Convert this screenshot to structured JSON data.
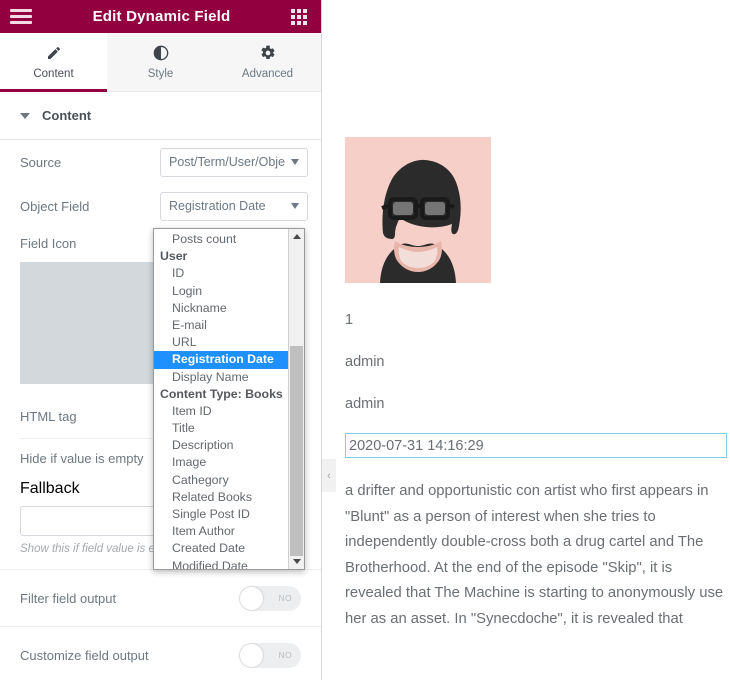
{
  "panel": {
    "title": "Edit Dynamic Field",
    "menu_icon": "hamburger-icon",
    "apps_icon": "grid-icon",
    "tabs": [
      {
        "label": "Content",
        "icon": "pencil-icon",
        "active": true
      },
      {
        "label": "Style",
        "icon": "contrast-icon",
        "active": false
      },
      {
        "label": "Advanced",
        "icon": "gear-icon",
        "active": false
      }
    ],
    "section": {
      "label": "Content",
      "expanded": true
    },
    "fields": {
      "source": {
        "label": "Source",
        "value": "Post/Term/User/Objec"
      },
      "object_field": {
        "label": "Object Field",
        "value": "Registration Date"
      },
      "field_icon": {
        "label": "Field Icon"
      },
      "html_tag": {
        "label": "HTML tag"
      },
      "hide_if_empty": {
        "label": "Hide if value is empty"
      },
      "fallback": {
        "label": "Fallback",
        "value": "",
        "hint": "Show this if field value is e"
      },
      "filter_field_output": {
        "label": "Filter field output",
        "state": "NO"
      },
      "customize_field_output": {
        "label": "Customize field output",
        "state": "NO"
      }
    }
  },
  "dropdown": {
    "selected": "Registration Date",
    "items": [
      {
        "label": "Posts count",
        "type": "item"
      },
      {
        "label": "User",
        "type": "group"
      },
      {
        "label": "ID",
        "type": "item"
      },
      {
        "label": "Login",
        "type": "item"
      },
      {
        "label": "Nickname",
        "type": "item"
      },
      {
        "label": "E-mail",
        "type": "item"
      },
      {
        "label": "URL",
        "type": "item"
      },
      {
        "label": "Registration Date",
        "type": "item",
        "selected": true
      },
      {
        "label": "Display Name",
        "type": "item"
      },
      {
        "label": "Content Type: Books",
        "type": "group"
      },
      {
        "label": "Item ID",
        "type": "item"
      },
      {
        "label": "Title",
        "type": "item"
      },
      {
        "label": "Description",
        "type": "item"
      },
      {
        "label": "Image",
        "type": "item"
      },
      {
        "label": "Cathegory",
        "type": "item"
      },
      {
        "label": "Related Books",
        "type": "item"
      },
      {
        "label": "Single Post ID",
        "type": "item"
      },
      {
        "label": "Item Author",
        "type": "item"
      },
      {
        "label": "Created Date",
        "type": "item"
      },
      {
        "label": "Modified Date",
        "type": "item"
      }
    ]
  },
  "preview": {
    "avatar_alt": "user-portrait",
    "line1": "1",
    "line2": "admin",
    "line3": "admin",
    "date_value": "2020-07-31 14:16:29",
    "paragraph": "a drifter and opportunistic con artist who first appears in \"Blunt\" as a person of interest when she tries to independently double-cross both a drug cartel and The Brotherhood. At the end of the episode \"Skip\", it is revealed that The Machine is starting to anonymously use her as an asset. In \"Synecdoche\", it is revealed that",
    "collapse_icon": "‹"
  },
  "colors": {
    "brand": "#93003f",
    "highlight": "#1e90ff",
    "field_border_focus": "#7ecfe6",
    "placeholder_box": "#d2d8dc"
  }
}
